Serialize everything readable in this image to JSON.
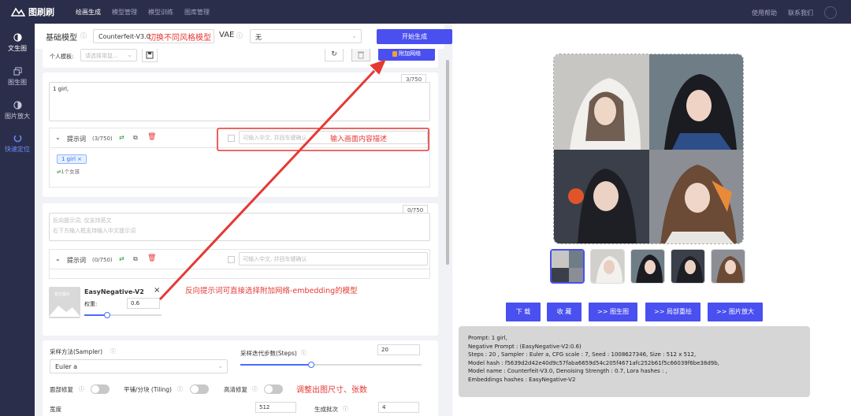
{
  "app": {
    "name": "图刷刷"
  },
  "topnav": [
    "绘画生成",
    "模型管理",
    "模型训练",
    "图库管理"
  ],
  "top_right": {
    "help": "使用帮助",
    "contact": "联系我们"
  },
  "sidebar": [
    {
      "label": "文生图",
      "icon": "half-circle-icon"
    },
    {
      "label": "图生图",
      "icon": "image-copy-icon"
    },
    {
      "label": "图片放大",
      "icon": "half-circle-icon"
    },
    {
      "label": "快速定位",
      "icon": "target-icon"
    }
  ],
  "header": {
    "base_model_label": "基础模型",
    "base_model_value": "Counterfeit-V3.0",
    "base_model_note": "切换不同风格模型",
    "vae_label": "VAE",
    "vae_value": "无",
    "generate_label": "开始生成",
    "generate_note": "生成"
  },
  "template": {
    "label": "个人模板:",
    "placeholder": "请选择用鼠...",
    "attach_network": "附加网络"
  },
  "positive": {
    "counter": "3/750",
    "text": "1 girl,",
    "section_label": "提示词",
    "section_count": "(3/750)",
    "input_placeholder": "可输入中文, 并回车键确认",
    "note": "输入画面内容描述",
    "tag": "1 girl",
    "tag_cn": "1个女孩"
  },
  "negative": {
    "counter": "0/750",
    "placeholder_1": "反向提示词, 仅支持英文",
    "placeholder_2": "右下方输入框支持输入中文提示词",
    "section_label": "提示词",
    "section_count": "(0/750)",
    "input_placeholder": "可输入中文, 并回车键确认",
    "embedding_name": "EasyNegative-V2",
    "weight_label": "权重:",
    "weight_value": "0.6",
    "weight_fraction": 0.3,
    "no_image": "暂无图片",
    "note": "反向提示词可直接选择附加网络-embedding的模型"
  },
  "params": {
    "sampler_label": "采样方法(Sampler)",
    "sampler_value": "Euler a",
    "steps_label": "采样迭代步数(Steps)",
    "steps_value": "20",
    "steps_fraction": 0.39,
    "face_fix": "面部修复",
    "tiling": "平铺/分块 (Tiling)",
    "hires": "高清修复",
    "size_note": "调整出图尺寸、张数",
    "width_label": "宽度",
    "width_value": "512",
    "batch_label": "生成批次",
    "batch_value": "4"
  },
  "actions": [
    "下 载",
    "收 藏",
    ">> 图生图",
    ">> 局部重绘",
    ">> 图片放大"
  ],
  "info_lines": [
    "Prompt: 1 girl,",
    "Negative Prompt : (EasyNegative-V2:0.6)",
    "Steps : 20 , Sampler : Euler a, CFG scale : 7, Seed : 1008627346, Size : 512 x 512,",
    "Model hash : f5639d2d42e40d9c57faba6659d54c205f4671afc252b61f5c66039f6be38d9b,",
    "Model name : Counterfeit-V3.0, Denoising Strength : 0.7, Lora hashes : ,",
    "Embeddings hashes : EasyNegative-V2"
  ],
  "colors": {
    "accent": "#4a4ff0",
    "annotation": "#e53935",
    "nav_bg": "#2b2e4a"
  }
}
